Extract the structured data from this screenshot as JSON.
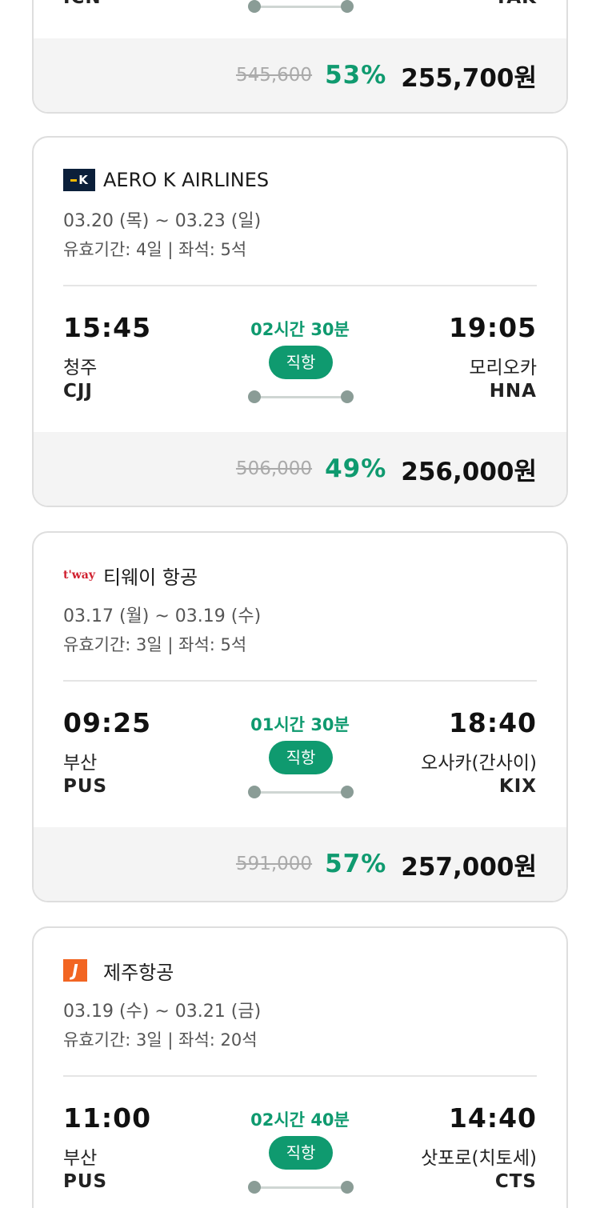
{
  "partial_top_card": {
    "dep_code": "ICN",
    "arr_code": "TAK",
    "original_price": "545,600",
    "discount": "53%",
    "price": "255,700원"
  },
  "cards": [
    {
      "airline": "AERO K AIRLINES",
      "logo_icon": "aero-k-logo",
      "dates": "03.20 (목) ~ 03.23 (일)",
      "validity": "유효기간: 4일 | 좌석: 5석",
      "dep_time": "15:45",
      "dep_city": "청주",
      "dep_code": "CJJ",
      "duration": "02시간 30분",
      "direct_label": "직항",
      "arr_time": "19:05",
      "arr_city": "모리오카",
      "arr_code": "HNA",
      "original_price": "506,000",
      "discount": "49%",
      "price": "256,000원"
    },
    {
      "airline": "티웨이 항공",
      "logo_icon": "tway-logo",
      "dates": "03.17 (월) ~ 03.19 (수)",
      "validity": "유효기간: 3일 | 좌석: 5석",
      "dep_time": "09:25",
      "dep_city": "부산",
      "dep_code": "PUS",
      "duration": "01시간 30분",
      "direct_label": "직항",
      "arr_time": "18:40",
      "arr_city": "오사카(간사이)",
      "arr_code": "KIX",
      "original_price": "591,000",
      "discount": "57%",
      "price": "257,000원"
    },
    {
      "airline": "제주항공",
      "logo_icon": "jeju-air-logo",
      "dates": "03.19 (수) ~ 03.21 (금)",
      "validity": "유효기간: 3일 | 좌석: 20석",
      "dep_time": "11:00",
      "dep_city": "부산",
      "dep_code": "PUS",
      "duration": "02시간 40분",
      "direct_label": "직항",
      "arr_time": "14:40",
      "arr_city": "삿포로(치토세)",
      "arr_code": "CTS"
    }
  ],
  "logos": {
    "aerok_text": "K",
    "tway_text": "t'way",
    "jeju_text": "J"
  },
  "colors": {
    "accent_green": "#0f9a6f",
    "card_border": "#dedede",
    "price_bg": "#f4f4f4"
  }
}
